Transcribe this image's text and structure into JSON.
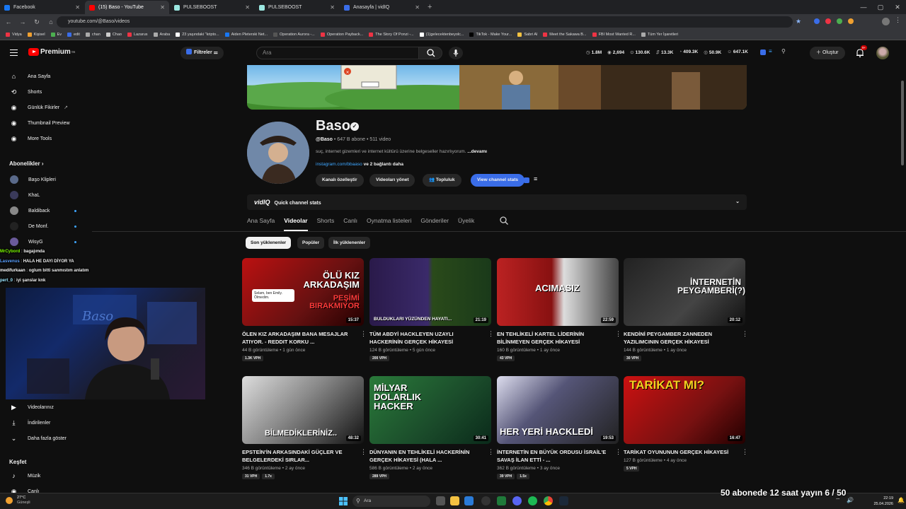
{
  "browser": {
    "tabs": [
      {
        "title": "Facebook",
        "color": "#1877f2",
        "active": false
      },
      {
        "title": "(15) Baso - YouTube",
        "color": "#ff0000",
        "active": true
      },
      {
        "title": "PULSEBOOST",
        "color": "#9be7e0",
        "active": false
      },
      {
        "title": "PULSEBOOST",
        "color": "#9be7e0",
        "active": false
      },
      {
        "title": "Anasayfa | vidIQ",
        "color": "#3a6de8",
        "active": false
      }
    ],
    "url": "youtube.com/@Baso/videos",
    "bookmarks": [
      "Vidya",
      "Kişisel",
      "Ev",
      "edit",
      "chan",
      "Chao",
      "Lazarus",
      "Araba",
      "23 yaşındaki \"kripto...",
      "Aiden Pleterski Net...",
      "Operation Aurora -...",
      "Operation Payback...",
      "The Story Of Ponzi -...",
      "(1)gelecektenbeyolc...",
      "TikTok - Make Your...",
      "Sabri Al",
      "Meet the Sakawa B...",
      "FBI Most Wanted R...",
      "Tüm Yer İşaretleri"
    ]
  },
  "header": {
    "logo_text": "Premium",
    "logo_sup": "TR",
    "filters_label": "Filtreler",
    "search_placeholder": "Ara",
    "stats": [
      "1.8M",
      "2,694",
      "130.6K",
      "13.3K",
      "409.3K",
      "50.9K",
      "647.1K"
    ],
    "create_label": "Oluştur",
    "notif_count": "9+"
  },
  "sidebar": {
    "main": [
      {
        "label": "Ana Sayfa",
        "icon": "home-icon"
      },
      {
        "label": "Shorts",
        "icon": "shorts-icon"
      },
      {
        "label": "Günlük Fikirler",
        "icon": "idea-icon"
      },
      {
        "label": "Thumbnail Preview",
        "icon": "preview-icon"
      },
      {
        "label": "More Tools",
        "icon": "tools-icon"
      }
    ],
    "subs_heading": "Abonelikler",
    "subs": [
      {
        "label": "Başo Klipleri",
        "color": "#5a6a8a",
        "dot": false
      },
      {
        "label": "KhaL",
        "color": "#3a3a5a",
        "dot": false
      },
      {
        "label": "Baldiback",
        "color": "#888",
        "dot": true
      },
      {
        "label": "De Monf.",
        "color": "#222",
        "dot": true
      },
      {
        "label": "WisyG",
        "color": "#6a5a9a",
        "dot": true
      }
    ],
    "you_items": [
      {
        "label": "Videolarınız",
        "icon": "your-videos-icon"
      },
      {
        "label": "İndirilenler",
        "icon": "download-icon"
      },
      {
        "label": "Daha fazla göster",
        "icon": "chevron-down-icon"
      }
    ],
    "explore_heading": "Keşfet",
    "explore_items": [
      {
        "label": "Müzik",
        "icon": "music-icon"
      },
      {
        "label": "Canlı",
        "icon": "live-icon"
      }
    ]
  },
  "chat": [
    {
      "user": "MrCybord",
      "msg": "bagajımda",
      "color": "#7cfc00"
    },
    {
      "user": "Lasvenus",
      "msg": "HALA HE DAYI DİYOR YA",
      "color": "#5aa0ff"
    },
    {
      "user": "medifurkaan",
      "msg": "oglum bitti sanmıstım anlatım",
      "color": "#ffffff"
    },
    {
      "user": "pert_0",
      "msg": "iyi şanslar knk",
      "color": "#9be7ff"
    }
  ],
  "channel": {
    "name": "Baso",
    "handle": "@Baso",
    "subs": "647 B abone",
    "videos": "511 video",
    "description": "suç, internet gizemleri ve internet kültürü üzerine belgeseller hazırlıyorum.",
    "more": "...devamı",
    "link": "instagram.com/bbaaso",
    "link_more": "ve 2 bağlantı daha",
    "buttons": [
      "Kanalı özelleştir",
      "Videoları yönet",
      "Topluluk"
    ],
    "stats_button": "View channel stats",
    "vidiq_brand": "vidIQ",
    "vidiq_bar": "Quick channel stats"
  },
  "tabs": [
    "Ana Sayfa",
    "Videolar",
    "Shorts",
    "Canlı",
    "Oynatma listeleri",
    "Gönderiler",
    "Üyelik"
  ],
  "active_tab": "Videolar",
  "chips": [
    "Son yüklenenler",
    "Popüler",
    "İlk yüklenenler"
  ],
  "videos": [
    {
      "title": "ÖLEN KIZ ARKADAŞIM BANA MESAJLAR ATIYOR. - Reddit Korku ...",
      "views": "44 B görüntüleme",
      "age": "1 gün önce",
      "duration": "15:37",
      "badges": [
        "1.3K VPH"
      ],
      "thumb_text": "ÖLÜ KIZ ARKADAŞIM",
      "thumb_text2": "PEŞİMİ BIRAKMIYOR",
      "thumb_note": "Selam, ben Emily. Ölmedim."
    },
    {
      "title": "TÜM ABDYİ HACKLEYEN UZAYLI HACKERİNİN GERÇEK HİKAYESİ",
      "views": "124 B görüntüleme",
      "age": "5 gün önce",
      "duration": "21:19",
      "badges": [
        "200 VPH"
      ],
      "thumb_text": "BULDUKLARI YÜZÜNDEN HAYATI..."
    },
    {
      "title": "EN TEHLİKELİ KARTEL LİDERİNİN BİLİNMEYEN GERÇEK HİKAYESİ",
      "views": "160 B görüntüleme",
      "age": "1 ay önce",
      "duration": "22:59",
      "badges": [
        "43 VPH"
      ],
      "thumb_text": "ACIMASIZ"
    },
    {
      "title": "KENDİNİ PEYGAMBER ZANNEDEN YAZILIMCININ GERÇEK HİKAYESİ",
      "views": "144 B görüntüleme",
      "age": "1 ay önce",
      "duration": "20:12",
      "badges": [
        "30 VPH"
      ],
      "thumb_text": "İNTERNETİN PEYGAMBERİ(?)"
    },
    {
      "title": "EPSTEİN'İN ARKASINDAKİ GÜÇLER VE BELGELERDEKİ SIRLAR...",
      "views": "346 B görüntüleme",
      "age": "2 ay önce",
      "duration": "48:32",
      "badges": [
        "31 VPH",
        "1.7x"
      ],
      "thumb_text": "BİLMEDİKLERİNİZ.."
    },
    {
      "title": "DÜNYANIN EN TEHLİKELİ HACKERİNİN GERÇEK HİKAYESİ (HALA ...",
      "views": "586 B görüntüleme",
      "age": "2 ay önce",
      "duration": "30:41",
      "badges": [
        "289 VPH"
      ],
      "thumb_text": "MİLYAR DOLARLIK HACKER"
    },
    {
      "title": "İNTERNETİN EN BÜYÜK ORDUSU İSRAİL'E SAVAŞ İLAN ETTİ - ...",
      "views": "362 B görüntüleme",
      "age": "3 ay önce",
      "duration": "19:53",
      "badges": [
        "39 VPH",
        "1.5x"
      ],
      "thumb_text": "HER YERİ HACKLEDİ"
    },
    {
      "title": "TARİKAT OYUNUNUN GERÇEK HİKAYESİ",
      "views": "127 B görüntüleme",
      "age": "4 ay önce",
      "duration": "16:47",
      "badges": [
        "5 VPH"
      ],
      "thumb_text": "TARİKAT MI?"
    }
  ],
  "taskbar": {
    "temp": "27°C",
    "weather": "Güneşli",
    "search": "Ara",
    "time": "22:19",
    "date": "25.04.2026"
  },
  "overlay_goal": "50 abonede 12 saat yayın 6 / 50"
}
